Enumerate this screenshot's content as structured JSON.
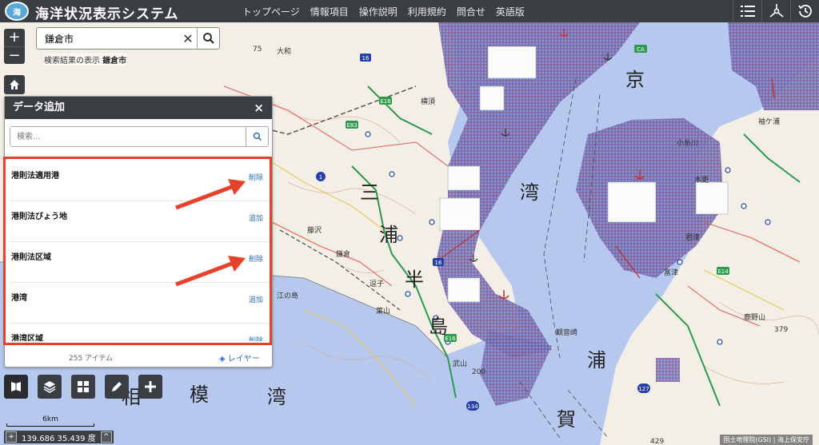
{
  "header": {
    "logo_text": "海",
    "title": "海洋状況表示システム",
    "nav": [
      "トップページ",
      "情報項目",
      "操作説明",
      "利用規約",
      "問合せ",
      "英語版"
    ],
    "icons": [
      "list-icon",
      "share-icon",
      "history-icon"
    ]
  },
  "map": {
    "labels": {
      "kyo": "京",
      "wan1": "湾",
      "miura1": "三",
      "miura2": "浦",
      "miura3": "半",
      "miura4": "島",
      "uraga1": "浦",
      "uraga2": "賀",
      "sagami1": "模",
      "sagami2": "湾",
      "sagami3": "相"
    },
    "place_labels": {
      "yokosuka": "横須",
      "fujisawa": "藤沢",
      "kamakura": "鎌倉",
      "enoshima": "江の島",
      "hayama": "葉山",
      "zushi": "逗子",
      "kisarazu": "木更",
      "kimitsu": "君津",
      "futtsu": "富津",
      "sodegaura": "袖ケ浦",
      "kanonzaki": "観音崎",
      "takeyama": "武山",
      "kanozan": "鹿野山",
      "kurihama": "小糸川",
      "yamato": "大和",
      "h75": "75",
      "h200": "200",
      "h379": "379",
      "h429": "429"
    },
    "routes": [
      "16",
      "E16",
      "E83",
      "1",
      "16",
      "134",
      "127",
      "E14",
      "CA",
      "16"
    ],
    "attribution": "国土地理院(GSI) | 海上保安庁"
  },
  "search": {
    "value": "鎌倉市",
    "result_prefix": "検索結果の表示",
    "result_value": "鎌倉市"
  },
  "panel": {
    "title": "データ追加",
    "close": "×",
    "search_placeholder": "検索...",
    "items": [
      {
        "name": "港則法適用港",
        "action": "削除"
      },
      {
        "name": "港則法びょう地",
        "action": "追加"
      },
      {
        "name": "港則法区域",
        "action": "削除"
      },
      {
        "name": "港湾",
        "action": "追加"
      },
      {
        "name": "港湾区域",
        "action": "削除"
      }
    ],
    "count": "255 アイテム",
    "layer_link": "レイヤー"
  },
  "footer": {
    "scale_label": "6km",
    "coord_plus": "+",
    "coordinates": "139.686 35.439 度",
    "coord_toggle": "^"
  },
  "colors": {
    "header_bg": "#3a3d42",
    "sea": "#b7c8ef",
    "harbor_area": "#6d6fb8",
    "highlight": "#e8412b",
    "link": "#2a6db0"
  }
}
